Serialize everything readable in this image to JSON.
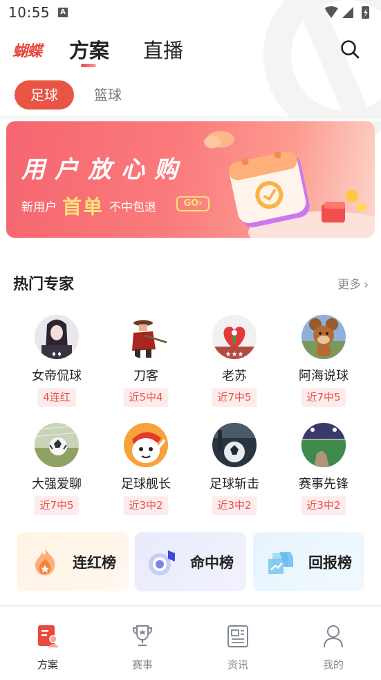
{
  "status_bar": {
    "time": "10:55",
    "notification_icon": "A"
  },
  "header": {
    "logo": "蝴蝶",
    "tabs": [
      {
        "label": "方案",
        "active": true
      },
      {
        "label": "直播",
        "active": false
      }
    ],
    "search_icon": "search-icon"
  },
  "sport_tabs": [
    {
      "label": "足球",
      "active": true
    },
    {
      "label": "篮球",
      "active": false
    }
  ],
  "banner": {
    "title": "用户放心购",
    "sub_prefix": "新用户",
    "sub_highlight": "首单",
    "sub_suffix": "不中包退",
    "go_label": "GO›"
  },
  "experts_section": {
    "title": "热门专家",
    "more_label": "更多",
    "experts": [
      {
        "name": "女帝侃球",
        "badge": "4连红"
      },
      {
        "name": "刀客",
        "badge": "近5中4"
      },
      {
        "name": "老苏",
        "badge": "近7中5"
      },
      {
        "name": "阿海说球",
        "badge": "近7中5"
      },
      {
        "name": "大强爱聊",
        "badge": "近7中5"
      },
      {
        "name": "足球舰长",
        "badge": "近3中2"
      },
      {
        "name": "足球斩击",
        "badge": "近3中2"
      },
      {
        "name": "赛事先锋",
        "badge": "近3中2"
      }
    ]
  },
  "rank_buttons": [
    {
      "label": "连红榜",
      "icon": "flame-icon"
    },
    {
      "label": "命中榜",
      "icon": "target-icon"
    },
    {
      "label": "回报榜",
      "icon": "trend-icon"
    }
  ],
  "bottom_nav": [
    {
      "label": "方案",
      "icon": "plan-icon",
      "active": true
    },
    {
      "label": "赛事",
      "icon": "trophy-icon",
      "active": false
    },
    {
      "label": "资讯",
      "icon": "news-icon",
      "active": false
    },
    {
      "label": "我的",
      "icon": "profile-icon",
      "active": false
    }
  ],
  "colors": {
    "accent": "#e85545",
    "badge_bg": "#fdecec",
    "badge_text": "#e5534a"
  }
}
